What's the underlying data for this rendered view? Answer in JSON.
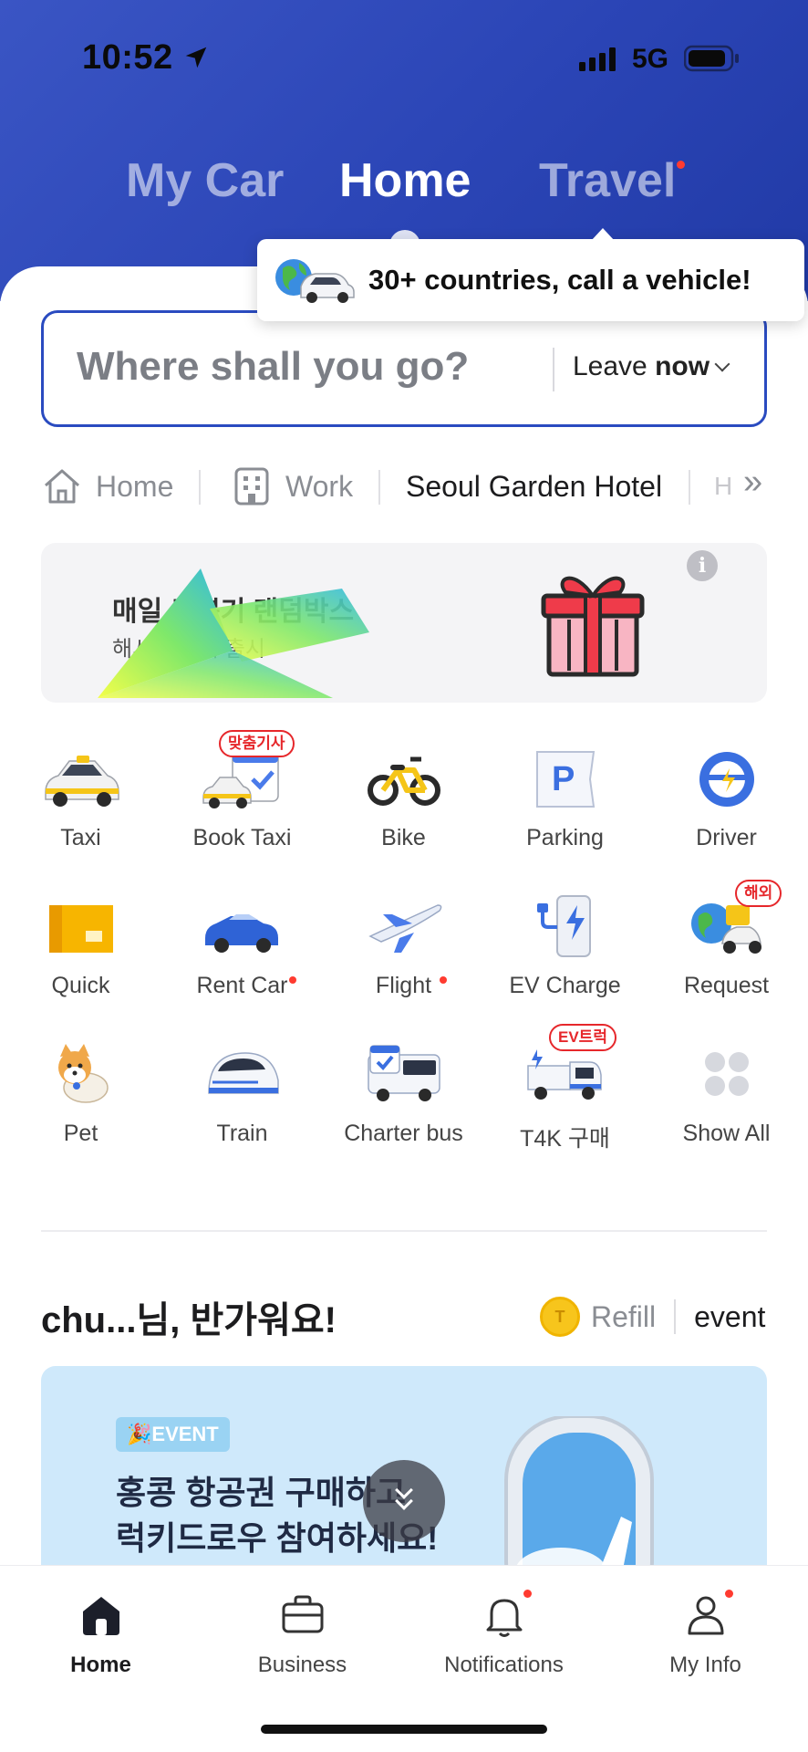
{
  "status_bar": {
    "time": "10:52",
    "network": "5G"
  },
  "mode_tabs": [
    {
      "label": "My Car",
      "active": false
    },
    {
      "label": "Home",
      "active": true
    },
    {
      "label": "Travel",
      "active": false,
      "has_dot": true
    }
  ],
  "tooltip": {
    "text": "30+ countries, call a vehicle!",
    "icon": "globe-car-icon"
  },
  "search": {
    "placeholder": "Where shall you go?",
    "leave_prefix": "Leave ",
    "leave_value": "now"
  },
  "shortcuts": [
    {
      "label": "Home",
      "icon": "home-icon"
    },
    {
      "label": "Work",
      "icon": "building-icon"
    },
    {
      "label": "Seoul Garden Hotel"
    },
    {
      "label": "H"
    }
  ],
  "banner": {
    "title": "매일 로뽑기 랜덤박스",
    "subtitle": "해시 표뽑기 출시",
    "info": "i"
  },
  "services": [
    {
      "label": "Taxi",
      "icon": "taxi-icon"
    },
    {
      "label": "Book Taxi",
      "icon": "book-taxi-icon",
      "badge": "맞춤기사"
    },
    {
      "label": "Bike",
      "icon": "bike-icon"
    },
    {
      "label": "Parking",
      "icon": "parking-icon",
      "glyph": "P"
    },
    {
      "label": "Driver",
      "icon": "steering-wheel-icon"
    },
    {
      "label": "Quick",
      "icon": "box-icon"
    },
    {
      "label": "Rent Car",
      "icon": "rent-car-icon",
      "has_dot": true
    },
    {
      "label": "Flight",
      "icon": "airplane-icon",
      "has_dot": true
    },
    {
      "label": "EV Charge",
      "icon": "ev-charger-icon"
    },
    {
      "label": "Request",
      "icon": "globe-scooter-icon",
      "badge": "해외"
    },
    {
      "label": "Pet",
      "icon": "dog-icon"
    },
    {
      "label": "Train",
      "icon": "train-icon"
    },
    {
      "label": "Charter bus",
      "icon": "bus-icon"
    },
    {
      "label": "T4K 구매",
      "icon": "truck-icon",
      "badge": "EV트럭"
    },
    {
      "label": "Show All",
      "icon": "grid-dots-icon"
    }
  ],
  "greeting": {
    "text": "chu...님, 반가워요!",
    "coin_glyph": "T",
    "refill": "Refill",
    "event": "event"
  },
  "event_card": {
    "badge": "🎉EVENT",
    "line1": "홍콩 항공권 구매하고",
    "line2": "럭키드로우 참여하세요!"
  },
  "bottom_nav": [
    {
      "label": "Home",
      "icon": "home-filled-icon",
      "active": true
    },
    {
      "label": "Business",
      "icon": "briefcase-icon"
    },
    {
      "label": "Notifications",
      "icon": "bell-icon",
      "has_dot": true
    },
    {
      "label": "My Info",
      "icon": "person-icon",
      "has_dot": true
    }
  ],
  "colors": {
    "brand_blue": "#2b45b6",
    "accent_red": "#ff3b30",
    "badge_red": "#e6272b"
  }
}
